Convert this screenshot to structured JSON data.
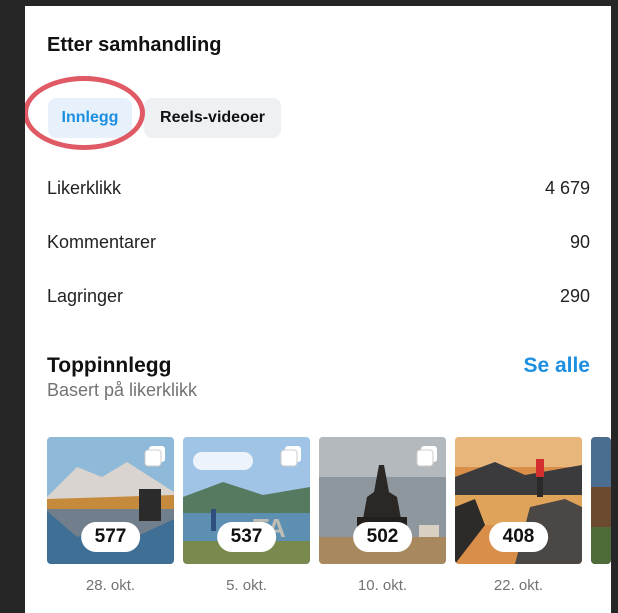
{
  "section": {
    "title": "Etter samhandling"
  },
  "tabs": [
    {
      "label": "Innlegg",
      "active": true
    },
    {
      "label": "Reels-videoer",
      "active": false
    }
  ],
  "metrics": [
    {
      "label": "Likerklikk",
      "value": "4 679"
    },
    {
      "label": "Kommentarer",
      "value": "90"
    },
    {
      "label": "Lagringer",
      "value": "290"
    }
  ],
  "top_posts": {
    "title": "Toppinnlegg",
    "subtitle": "Basert på likerklikk",
    "see_all": "Se alle",
    "posts": [
      {
        "count": "577",
        "date": "28. okt."
      },
      {
        "count": "537",
        "date": "5. okt."
      },
      {
        "count": "502",
        "date": "10. okt."
      },
      {
        "count": "408",
        "date": "22. okt."
      }
    ]
  },
  "colors": {
    "accent": "#1c8fe0",
    "annotation": "#e05a66",
    "background": "#262626"
  },
  "icons": [
    "multi-post-icon"
  ]
}
